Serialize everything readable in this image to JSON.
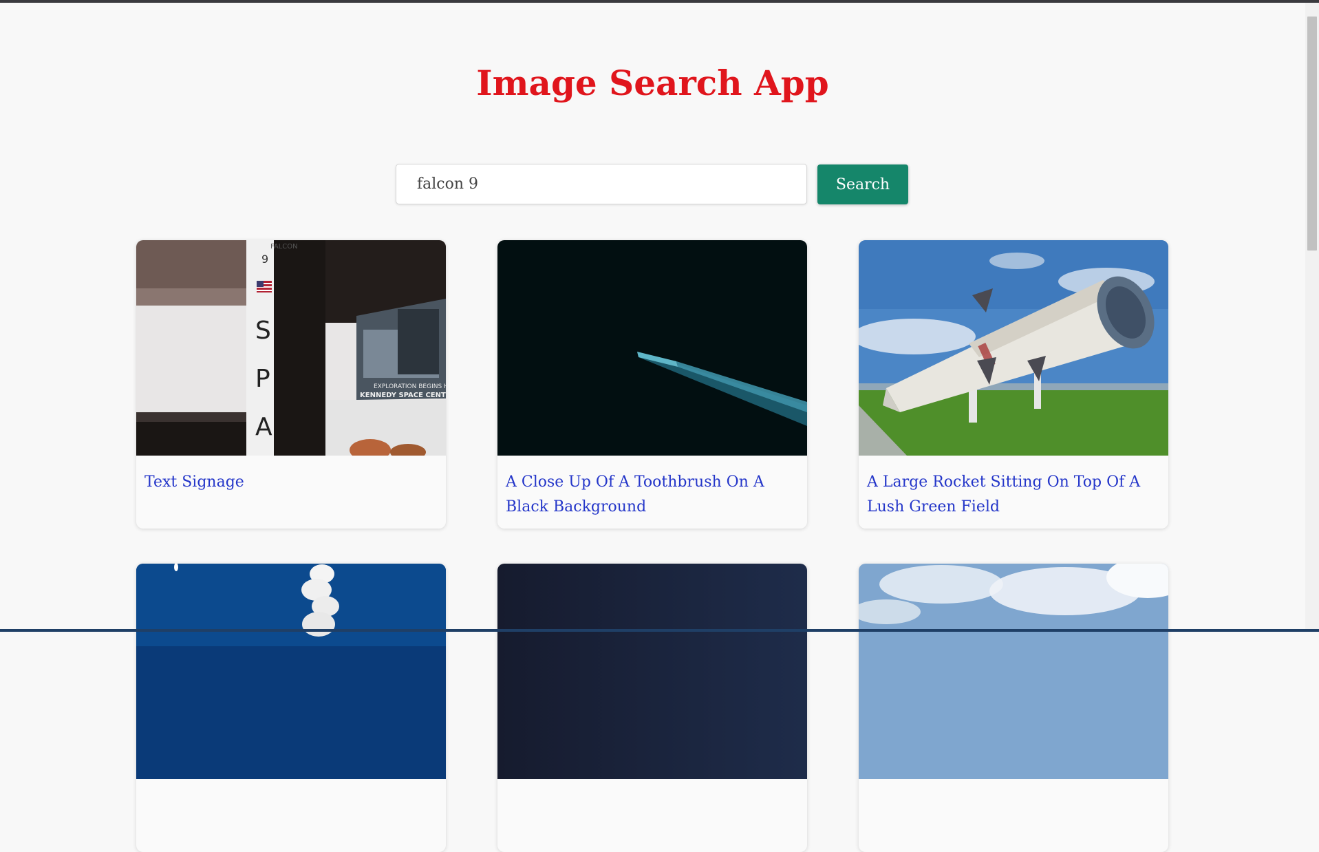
{
  "app": {
    "title": "Image Search App"
  },
  "search": {
    "value": "falcon 9",
    "button_label": "Search"
  },
  "results": [
    {
      "caption": "Text Signage",
      "icon": "falcon-9-rocket-signage-photo"
    },
    {
      "caption": "A Close Up Of A Toothbrush On A Black Background",
      "icon": "rocket-streak-dark-photo"
    },
    {
      "caption": "A Large Rocket Sitting On Top Of A Lush Green Field",
      "icon": "rocket-on-field-photo"
    },
    {
      "caption": "",
      "icon": "rocket-launch-smoke-photo"
    },
    {
      "caption": "",
      "icon": "dark-gradient-photo"
    },
    {
      "caption": "",
      "icon": "cloudy-sky-photo"
    }
  ],
  "colors": {
    "title": "#e0151c",
    "button": "#15866a",
    "caption_link": "#2436c9",
    "background": "#f8f8f8"
  },
  "image_text": {
    "falcon_label": "FALCON",
    "falcon_number": "9",
    "vertical_letters": [
      "S",
      "P",
      "A"
    ],
    "poster_line1": "EXPLORATION BEGINS HERE",
    "poster_line2": "KENNEDY SPACE CENTER"
  }
}
